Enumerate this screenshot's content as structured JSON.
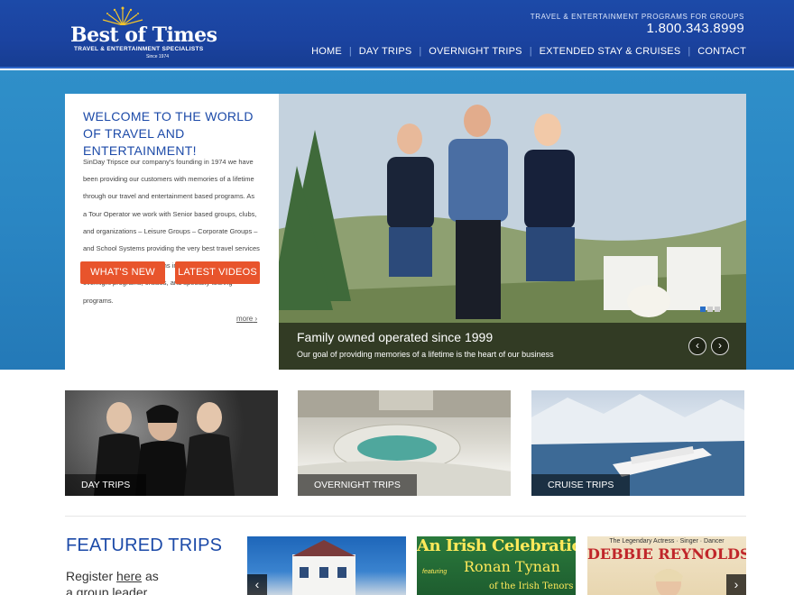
{
  "header": {
    "logo_title": "Best of Times",
    "logo_subtitle": "TRAVEL & ENTERTAINMENT SPECIALISTS",
    "logo_since": "Since 1974",
    "tagline": "TRAVEL & ENTERTAINMENT PROGRAMS FOR GROUPS",
    "phone": "1.800.343.8999",
    "nav": [
      "HOME",
      "DAY TRIPS",
      "OVERNIGHT TRIPS",
      "EXTENDED STAY & CRUISES",
      "CONTACT"
    ]
  },
  "welcome": {
    "title": "WELCOME TO THE WORLD OF TRAVEL AND ENTERTAINMENT!",
    "body": "SinDay Tripsce our company's founding in 1974 we have been providing our customers with memories of a lifetime through our travel and entertainment based programs. As a Tour Operator we work with Senior based groups, clubs, and organizations – Leisure Groups – Corporate Groups – and School Systems providing the very best travel services in the industry. Our programs include day trips, multi-day overnight programs, cruises, and specialty touring programs.",
    "more_label": "more",
    "button_news": "WHAT'S NEW",
    "button_videos": "LATEST VIDEOS"
  },
  "slider": {
    "caption_title": "Family owned operated since 1999",
    "caption_subtitle": "Our goal of providing memories of a lifetime is the heart of our business",
    "active_slide": 1,
    "slide_count": 3
  },
  "tiles": [
    {
      "label": "DAY TRIPS"
    },
    {
      "label": "OVERNIGHT TRIPS"
    },
    {
      "label": "CRUISE TRIPS"
    }
  ],
  "featured": {
    "title": "FEATURED TRIPS",
    "register_prefix": "Register ",
    "register_link": "here",
    "register_suffix": " as a group leader",
    "irish_title": "An Irish Celebration",
    "irish_featuring": "featuring",
    "irish_name": "Ronan Tynan",
    "irish_sub": "of the Irish Tenors",
    "debbie_legend": "The Legendary Actress · Singer · Dancer",
    "debbie_name": "DEBBIE REYNOLDS"
  },
  "colors": {
    "brand_blue": "#1c4aa8",
    "accent_orange": "#e8542c",
    "hero_blue": "#2a86c3"
  }
}
